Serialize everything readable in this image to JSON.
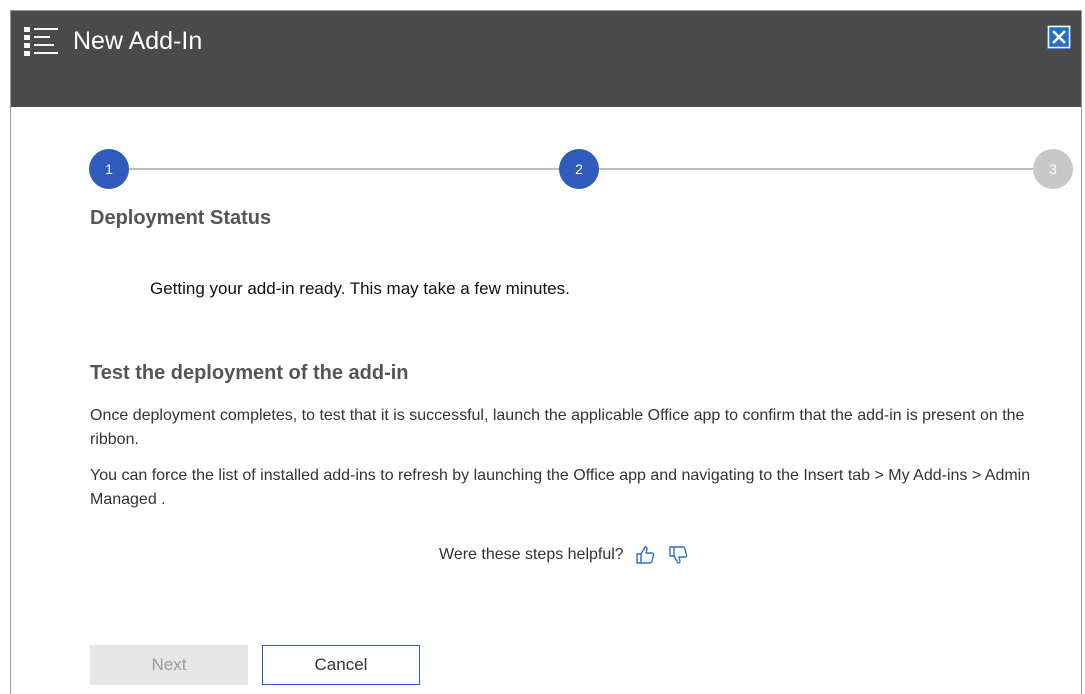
{
  "window": {
    "title": "New Add-In"
  },
  "steps": [
    {
      "number": "1",
      "state": "active"
    },
    {
      "number": "2",
      "state": "active"
    },
    {
      "number": "3",
      "state": "inactive"
    }
  ],
  "deployment": {
    "heading": "Deployment Status",
    "message": "Getting your add-in ready. This may take a few minutes."
  },
  "test": {
    "heading": "Test the deployment of the add-in",
    "paragraph1": "Once deployment completes, to test that it is successful, launch the applicable Office app to confirm that the add-in is present on the ribbon.",
    "paragraph2": "You can force the list of installed add-ins to refresh by launching the Office app and navigating to the Insert tab > My Add-ins > Admin Managed ."
  },
  "feedback": {
    "question": "Were these steps helpful?"
  },
  "buttons": {
    "next_label": "Next",
    "cancel_label": "Cancel"
  },
  "colors": {
    "titlebar": "#4a4a4a",
    "accent": "#2f5bbd",
    "inactive_step": "#c8c8c8"
  },
  "icons": {
    "menu": "list-icon",
    "close": "close-icon",
    "thumbs_up": "thumbs-up-icon",
    "thumbs_down": "thumbs-down-icon"
  }
}
